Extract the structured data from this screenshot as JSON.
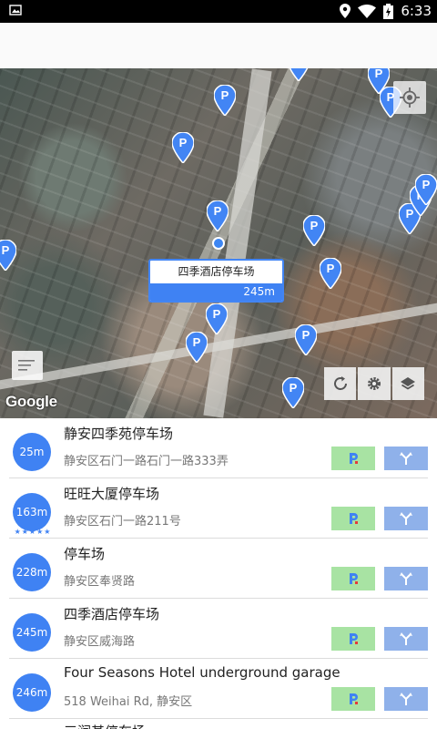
{
  "status_bar": {
    "time": "6:33"
  },
  "map": {
    "callout": {
      "name": "四季酒店停车场",
      "distance": "245m"
    },
    "attribution": "Google",
    "pin_glyph": "P"
  },
  "list": [
    {
      "distance": "25m",
      "name": "静安四季苑停车场",
      "address": "静安区石门一路石门一路333弄",
      "rating": ""
    },
    {
      "distance": "163m",
      "name": "旺旺大厦停车场",
      "address": "静安区石门一路211号",
      "rating": "★★★★★"
    },
    {
      "distance": "228m",
      "name": "停车场",
      "address": "静安区奉贤路",
      "rating": ""
    },
    {
      "distance": "245m",
      "name": "四季酒店停车场",
      "address": "静安区威海路",
      "rating": ""
    },
    {
      "distance": "246m",
      "name": "Four Seasons Hotel underground garage",
      "address": "518 Weihai Rd, 静安区",
      "rating": ""
    }
  ],
  "list_peek": "三润基停车场",
  "colors": {
    "accent": "#3f82f3",
    "parking_button": "#a8e3a3",
    "navigate_button": "#8fb1ea"
  }
}
